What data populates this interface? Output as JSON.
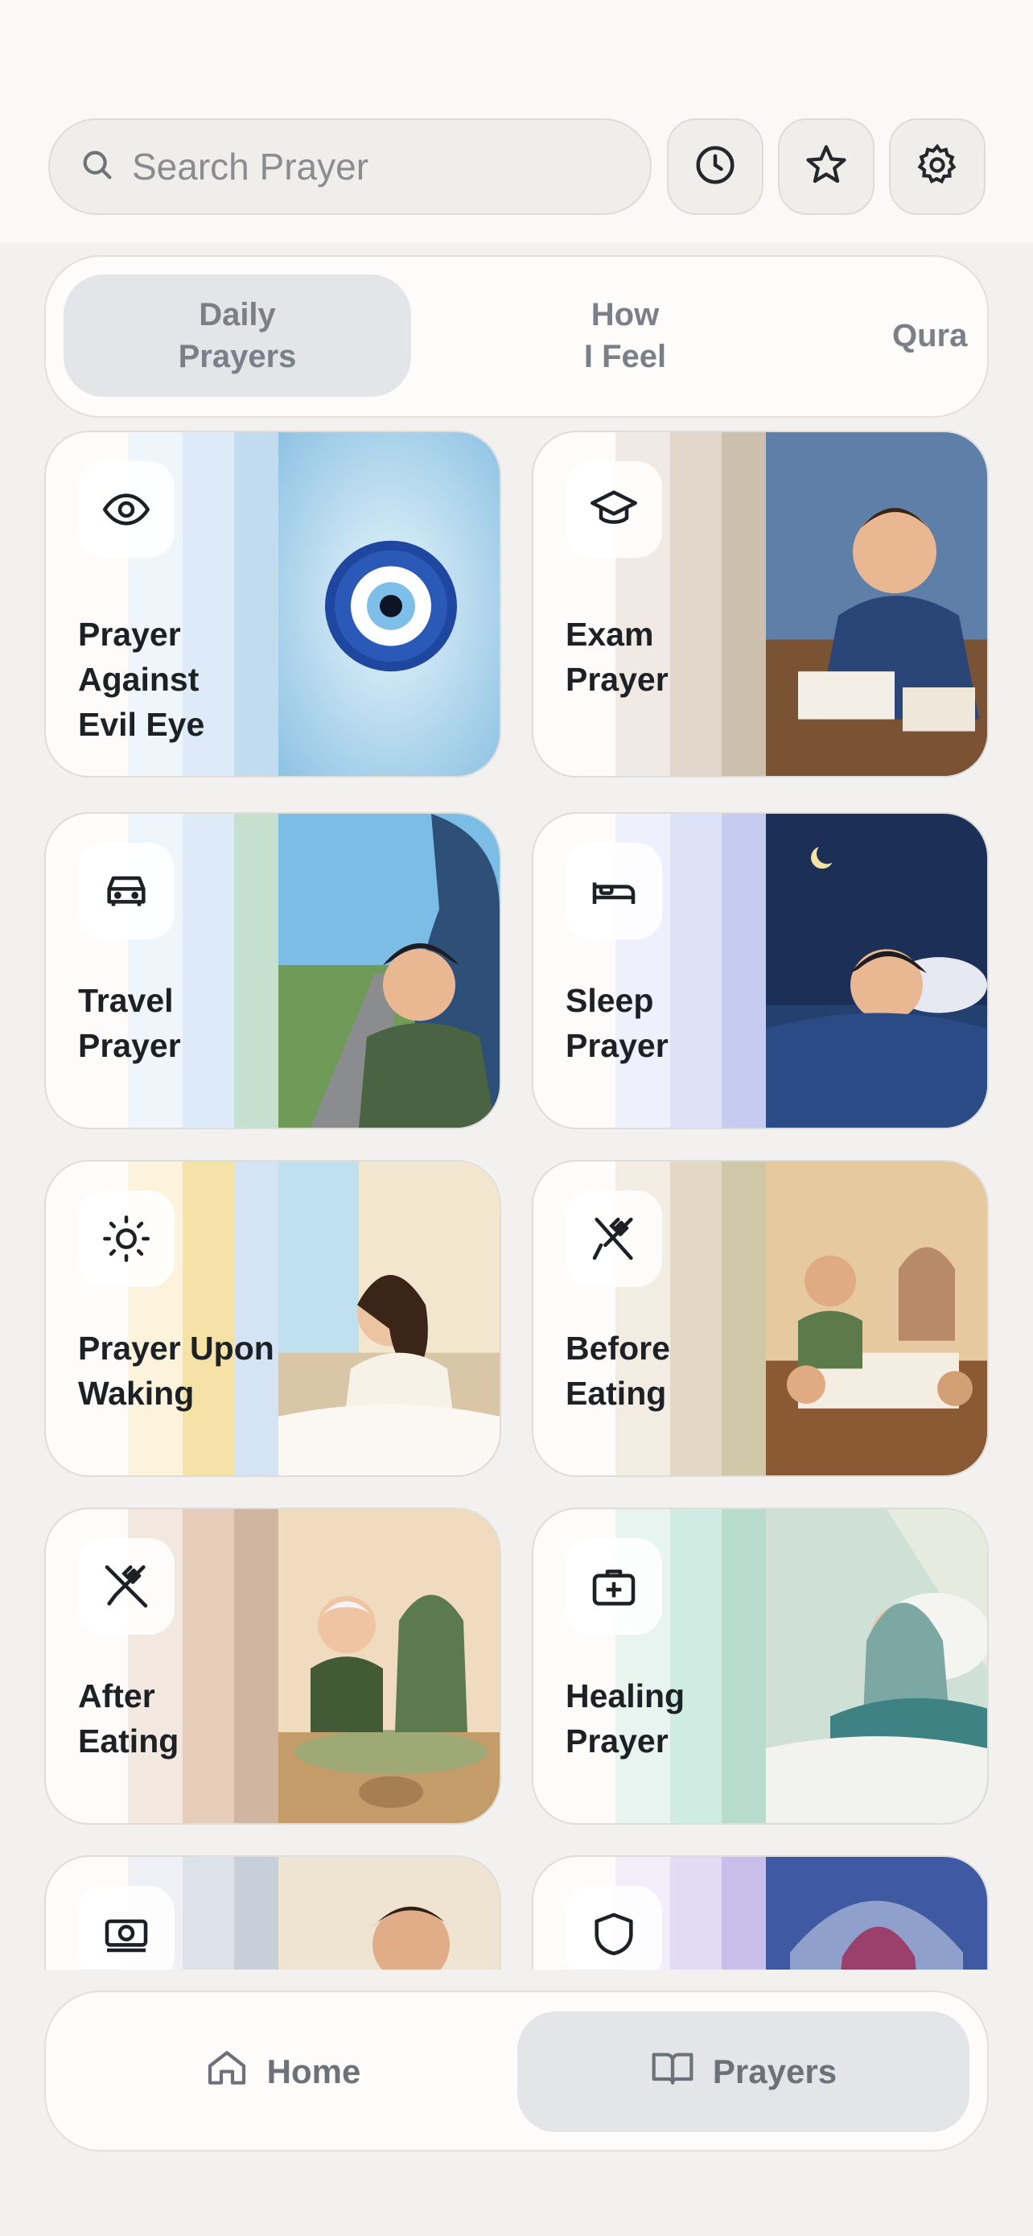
{
  "search": {
    "placeholder": "Search Prayer",
    "icon": "search-icon"
  },
  "toolbar": {
    "history_icon": "clock-icon",
    "favorites_icon": "star-icon",
    "settings_icon": "gear-icon"
  },
  "tabs": [
    {
      "label": "Daily\nPrayers",
      "active": true
    },
    {
      "label": "How\nI Feel",
      "active": false
    },
    {
      "label": "Qura",
      "active": false
    }
  ],
  "cards": [
    {
      "title": "Prayer\nAgainst\nEvil Eye",
      "icon": "eye-icon",
      "illustration": "evil eye amulet"
    },
    {
      "title": "Exam\nPrayer",
      "icon": "graduation-cap-icon",
      "illustration": "boy studying at desk"
    },
    {
      "title": "Travel\nPrayer",
      "icon": "car-icon",
      "illustration": "boy looking out of car window"
    },
    {
      "title": "Sleep\nPrayer",
      "icon": "bed-icon",
      "illustration": "boy sleeping at night"
    },
    {
      "title": "Prayer Upon\nWaking",
      "icon": "sun-icon",
      "illustration": "girl stretching in bed at sunrise"
    },
    {
      "title": "Before\nEating",
      "icon": "utensils-icon",
      "illustration": "family praying at dinner table"
    },
    {
      "title": "After\nEating",
      "icon": "utensils-crossed-icon",
      "illustration": "elderly couple after meal"
    },
    {
      "title": "Healing\nPrayer",
      "icon": "first-aid-kit-icon",
      "illustration": "woman resting in bed"
    },
    {
      "title": "",
      "icon": "money-icon",
      "illustration": "man praying"
    },
    {
      "title": "",
      "icon": "shield-icon",
      "illustration": "woman in hijab under mosque dome"
    }
  ],
  "bottom_nav": [
    {
      "label": "Home",
      "icon": "home-icon",
      "active": false
    },
    {
      "label": "Prayers",
      "icon": "book-open-icon",
      "active": true
    }
  ]
}
